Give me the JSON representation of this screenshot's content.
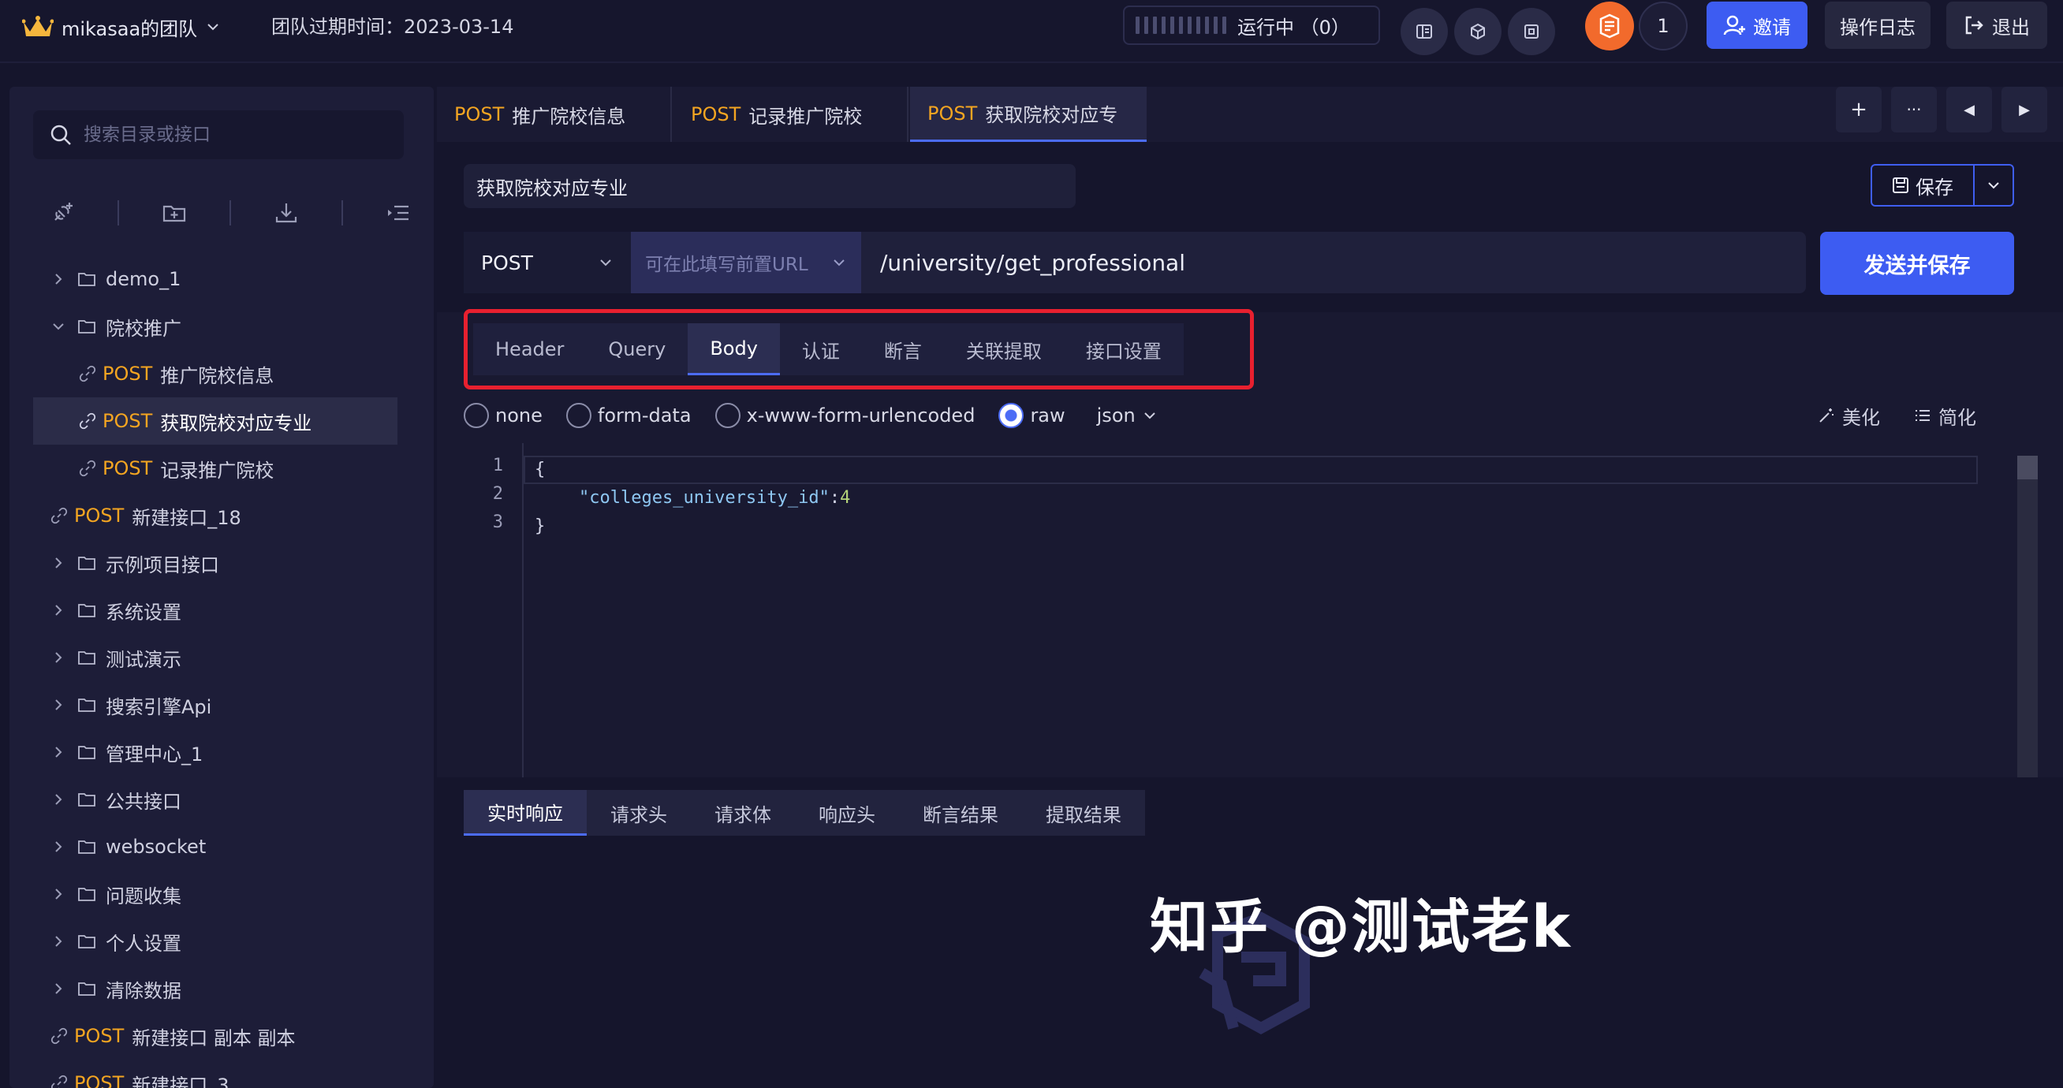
{
  "topbar": {
    "team_name": "mikasaa的团队",
    "expire_label": "团队过期时间：2023-03-14",
    "run_status": "运行中 （0）",
    "member_count": "1",
    "invite_label": "邀请",
    "oplog_label": "操作日志",
    "logout_label": "退出"
  },
  "sidebar": {
    "search_placeholder": "搜索目录或接口",
    "tree": [
      {
        "type": "folder",
        "label": "demo_1",
        "expanded": false
      },
      {
        "type": "folder",
        "label": "院校推广",
        "expanded": true
      },
      {
        "type": "api",
        "method": "POST",
        "label": "推广院校信息",
        "indent": 1
      },
      {
        "type": "api",
        "method": "POST",
        "label": "获取院校对应专业",
        "indent": 1,
        "selected": true
      },
      {
        "type": "api",
        "method": "POST",
        "label": "记录推广院校",
        "indent": 1
      },
      {
        "type": "api",
        "method": "POST",
        "label": "新建接口_18",
        "indent": 0
      },
      {
        "type": "folder",
        "label": "示例项目接口",
        "expanded": false
      },
      {
        "type": "folder",
        "label": "系统设置",
        "expanded": false
      },
      {
        "type": "folder",
        "label": "测试演示",
        "expanded": false
      },
      {
        "type": "folder",
        "label": "搜索引擎Api",
        "expanded": false
      },
      {
        "type": "folder",
        "label": "管理中心_1",
        "expanded": false
      },
      {
        "type": "folder",
        "label": "公共接口",
        "expanded": false
      },
      {
        "type": "folder",
        "label": "websocket",
        "expanded": false
      },
      {
        "type": "folder",
        "label": "问题收集",
        "expanded": false
      },
      {
        "type": "folder",
        "label": "个人设置",
        "expanded": false
      },
      {
        "type": "folder",
        "label": "清除数据",
        "expanded": false
      },
      {
        "type": "api",
        "method": "POST",
        "label": "新建接口 副本 副本",
        "indent": 0
      },
      {
        "type": "api",
        "method": "POST",
        "label": "新建接口_3",
        "indent": 0
      }
    ]
  },
  "tabs": [
    {
      "method": "POST",
      "label": "推广院校信息",
      "active": false
    },
    {
      "method": "POST",
      "label": "记录推广院校",
      "active": false
    },
    {
      "method": "POST",
      "label": "获取院校对应专",
      "active": true
    }
  ],
  "tab_controls": {
    "add": "+",
    "more": "···",
    "prev": "◀",
    "next": "▶"
  },
  "request": {
    "name": "获取院校对应专业",
    "save_label": "保存",
    "method": "POST",
    "prefix_placeholder": "可在此填写前置URL",
    "path": "/university/get_professional",
    "send_label": "发送并保存"
  },
  "request_tabs": [
    "Header",
    "Query",
    "Body",
    "认证",
    "断言",
    "关联提取",
    "接口设置"
  ],
  "request_tab_active": "Body",
  "body_modes": [
    "none",
    "form-data",
    "x-www-form-urlencoded",
    "raw"
  ],
  "body_mode_selected": "raw",
  "raw_format": "json",
  "format_buttons": {
    "beautify": "美化",
    "simplify": "简化"
  },
  "editor": {
    "line_numbers": [
      "1",
      "2",
      "3"
    ],
    "open_brace": "{",
    "key": "\"colleges_university_id\"",
    "colon": ":",
    "value": "4",
    "close_brace": "}"
  },
  "response_tabs": [
    "实时响应",
    "请求头",
    "请求体",
    "响应头",
    "断言结果",
    "提取结果"
  ],
  "response_tab_active": "实时响应",
  "watermark": "知乎 @测试老k",
  "colors": {
    "accent": "#3d5cf2",
    "method_post": "#f4a521",
    "highlight_border": "#e8202f"
  }
}
